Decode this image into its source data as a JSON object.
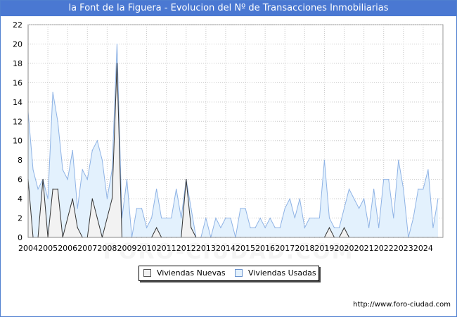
{
  "header": {
    "title": "la Font de la Figuera - Evolucion del Nº de Transacciones Inmobiliarias"
  },
  "footer": {
    "credit": "http://www.foro-ciudad.com"
  },
  "watermark": "FORO-CIUDAD.COM",
  "colors": {
    "title_bg": "#4a78d2",
    "usadas_fill": "#e3f1fd",
    "usadas_line": "#8fb3e5",
    "nuevas_fill": "#f2f2f2",
    "nuevas_line": "#333333",
    "grid": "#c8c8c8"
  },
  "chart_data": {
    "type": "area",
    "title": "la Font de la Figuera - Evolucion del Nº de Transacciones Inmobiliarias",
    "xlabel": "",
    "ylabel": "",
    "ylim": [
      0,
      22
    ],
    "yticks": [
      0,
      2,
      4,
      6,
      8,
      10,
      12,
      14,
      16,
      18,
      20,
      22
    ],
    "xticks": [
      "2004",
      "2005",
      "2006",
      "2007",
      "2008",
      "2009",
      "2010",
      "2011",
      "2012",
      "2013",
      "2014",
      "2015",
      "2016",
      "2017",
      "2018",
      "2019",
      "2020",
      "2021",
      "2022",
      "2023",
      "2024"
    ],
    "x_start": "2004Q1",
    "grid": true,
    "legend_position": "bottom-center",
    "series": [
      {
        "name": "Viviendas Nuevas",
        "values": [
          6,
          0,
          0,
          6,
          0,
          5,
          5,
          0,
          2,
          4,
          1,
          0,
          0,
          4,
          2,
          0,
          2,
          4,
          18,
          0,
          0,
          0,
          0,
          0,
          0,
          0,
          1,
          0,
          0,
          0,
          0,
          0,
          6,
          1,
          0,
          0,
          0,
          0,
          0,
          0,
          0,
          0,
          0,
          0,
          0,
          0,
          0,
          0,
          0,
          0,
          0,
          0,
          0,
          0,
          0,
          0,
          0,
          0,
          0,
          0,
          0,
          1,
          0,
          0,
          1,
          0,
          0,
          0,
          0,
          0,
          0,
          0,
          0,
          0,
          0,
          0,
          0,
          0,
          0,
          0,
          0,
          0,
          0,
          0
        ]
      },
      {
        "name": "Viviendas Usadas",
        "values": [
          13,
          7,
          5,
          6,
          4,
          15,
          12,
          7,
          6,
          9,
          3,
          7,
          6,
          9,
          10,
          8,
          4,
          7,
          20,
          2,
          6,
          0,
          3,
          3,
          1,
          2,
          5,
          2,
          2,
          2,
          5,
          2,
          6,
          3,
          0,
          0,
          2,
          0,
          2,
          1,
          2,
          2,
          0,
          3,
          3,
          1,
          1,
          2,
          1,
          2,
          1,
          1,
          3,
          4,
          2,
          4,
          1,
          2,
          2,
          2,
          8,
          2,
          1,
          1,
          3,
          5,
          4,
          3,
          4,
          1,
          5,
          1,
          6,
          6,
          2,
          8,
          5,
          0,
          2,
          5,
          5,
          7,
          1,
          4
        ]
      }
    ]
  }
}
